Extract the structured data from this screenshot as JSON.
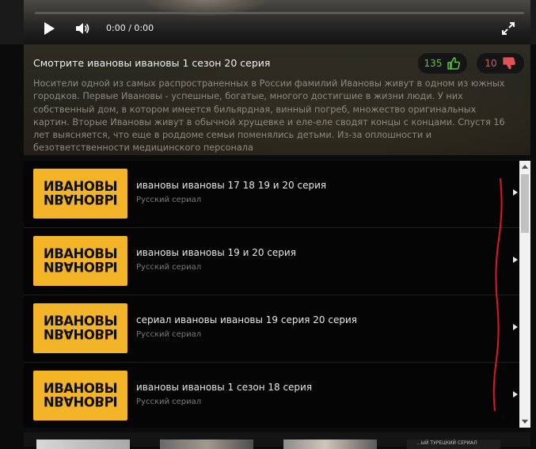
{
  "player": {
    "time": "0:00 / 0:00",
    "progress": 0
  },
  "info": {
    "title": "Смотрите ивановы ивановы 1 сезон 20 серия",
    "likes": "135",
    "dislikes": "10",
    "description": "Носители одной из самых распространенных в России фамилий Ивановы живут в одном из южных городков. Первые Ивановы - успешные, богатые, многого достигшие в жизни люди. У них собственный дом, в котором имеется бильярдная, винный погреб, множество оригинальных картин. Вторые Ивановы живут в обычной хрущевке и еле-еле сводят концы с концами. Спустя 16 лет выясняется, что еще в роддоме семьи поменялись детьми. Из-за оплошности и безответственности медицинского персонала"
  },
  "related": [
    {
      "logo": "ИВАНОВЫ",
      "title": "ивановы ивановы 17 18 19 и 20 серия",
      "subtitle": "Русский сериал"
    },
    {
      "logo": "ИВАНОВЫ",
      "title": "ивановы ивановы 19 и 20 серия",
      "subtitle": "Русский сериал"
    },
    {
      "logo": "ИВАНОВЫ",
      "title": "сериал ивановы ивановы 19 серия 20 серия",
      "subtitle": "Русский сериал"
    },
    {
      "logo": "ИВАНОВЫ",
      "title": "ивановы ивановы 1 сезон 18 серия",
      "subtitle": "Русский сериал"
    }
  ],
  "bottom_strip": {
    "caption": "...ЫЙ ТУРЕЦКИЙ СЕРИАЛ"
  },
  "colors": {
    "accent_yellow": "#f4b427",
    "like_green": "#5cc542",
    "dislike_red": "#e15454",
    "annotation_red": "#e0191f"
  },
  "icons": [
    "play-icon",
    "volume-icon",
    "fullscreen-icon",
    "thumbs-up-icon",
    "thumbs-down-icon",
    "chevron-right-icon"
  ]
}
